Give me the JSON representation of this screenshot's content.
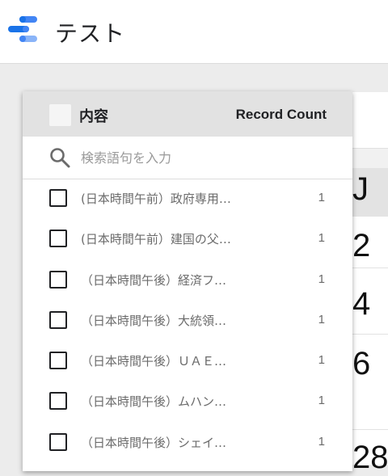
{
  "app": {
    "title": "テスト",
    "logo_icon": "data-studio-logo",
    "logo_colors": [
      "#4285F4",
      "#1A73E8",
      "#8AB4F8"
    ]
  },
  "background_table": {
    "header_partial": "J",
    "values": [
      "2",
      "4",
      "6",
      "28"
    ]
  },
  "filter_dropdown": {
    "dimension_label": "内容",
    "metric_label": "Record Count",
    "search": {
      "placeholder": "検索語句を入力",
      "value": ""
    },
    "items": [
      {
        "label": "(日本時間午前）政府専用…",
        "count": "1",
        "checked": false
      },
      {
        "label": "(日本時間午前）建国の父…",
        "count": "1",
        "checked": false
      },
      {
        "label": "（日本時間午後）経済フ…",
        "count": "1",
        "checked": false
      },
      {
        "label": "（日本時間午後）大統領…",
        "count": "1",
        "checked": false
      },
      {
        "label": "（日本時間午後）ＵＡＥ…",
        "count": "1",
        "checked": false
      },
      {
        "label": "（日本時間午後）ムハン…",
        "count": "1",
        "checked": false
      },
      {
        "label": "（日本時間午後）シェイ…",
        "count": "1",
        "checked": false
      }
    ]
  }
}
